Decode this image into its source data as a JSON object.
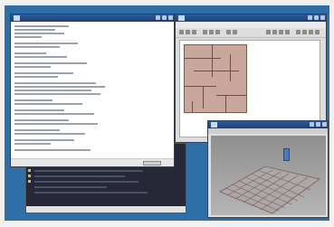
{
  "colors": {
    "desktop": "#2f6fa8",
    "titlebar": "#244b86",
    "map_wall": "#c9a79a",
    "terminal_bg": "#262837",
    "scene_floor": "#a8a8a8",
    "block": "#4a77c0"
  },
  "icons": [
    "window-icon",
    "minimize-icon",
    "maximize-icon",
    "close-icon",
    "toolbar-icon",
    "map-grid-icon",
    "3d-block-icon"
  ],
  "windows": {
    "console": {
      "title": ""
    },
    "editor": {
      "title": ""
    },
    "terminal": {
      "title": ""
    },
    "viewport": {
      "title": ""
    }
  }
}
